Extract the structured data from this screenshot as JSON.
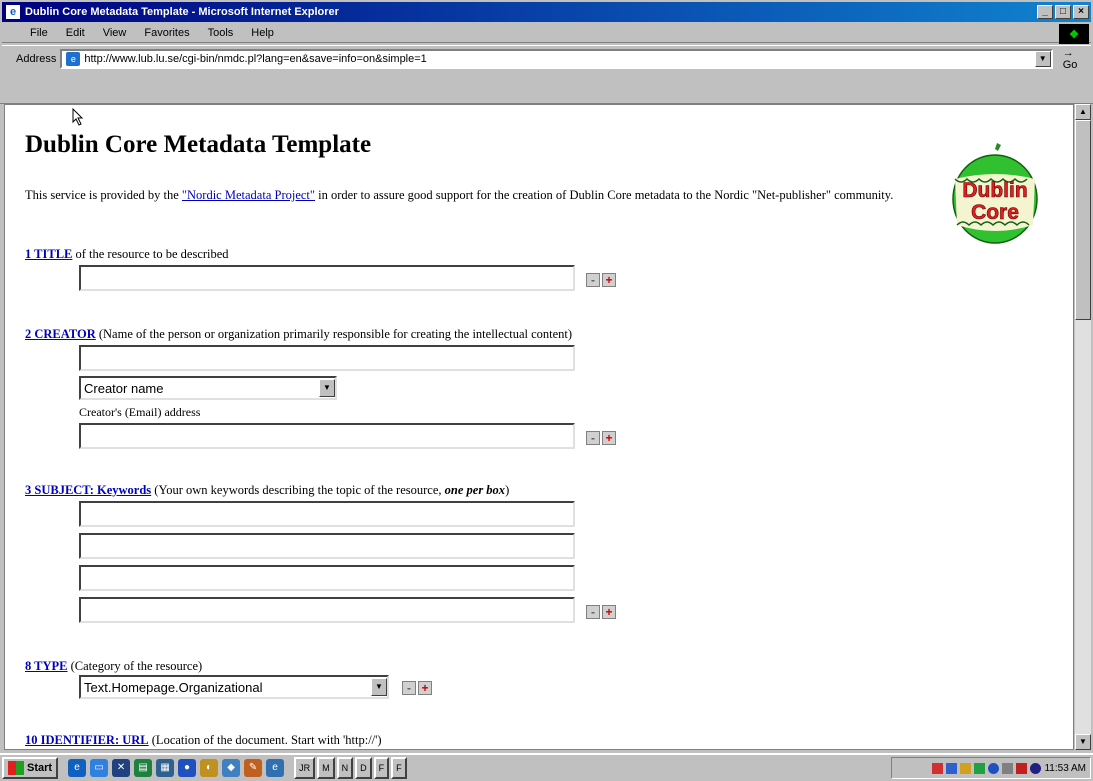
{
  "window": {
    "title": "Dublin Core Metadata Template - Microsoft Internet Explorer",
    "controls": [
      "_",
      "□",
      "×"
    ]
  },
  "menu": {
    "items": [
      "File",
      "Edit",
      "View",
      "Favorites",
      "Tools",
      "Help"
    ]
  },
  "address": {
    "label": "Address",
    "url": "http://www.lub.lu.se/cgi-bin/nmdc.pl?lang=en&save=info=on&simple=1",
    "go": "Go"
  },
  "page": {
    "title": "Dublin Core Metadata Template",
    "intro_before": "This service is provided by the ",
    "intro_link": "\"Nordic Metadata Project\"",
    "intro_after": " in order to assure good support for the creation of Dublin Core metadata to the Nordic \"Net-publisher\" community.",
    "logo_text_1": "Dublin",
    "logo_text_2": "Core"
  },
  "fields": {
    "title": {
      "link": "1 TITLE",
      "desc": " of the resource to be described"
    },
    "creator": {
      "link": "2 CREATOR",
      "desc": " (Name of the person or organization primarily responsible for creating the intellectual content)",
      "select_value": "Creator name",
      "email_label": "Creator's (Email) address"
    },
    "subject": {
      "link": "3 SUBJECT: Keywords",
      "desc_before": " (Your own keywords describing the topic of the resource, ",
      "desc_emph": "one per box",
      "desc_after": ")"
    },
    "type": {
      "link": "8 TYPE",
      "desc": " (Category of the resource)",
      "select_value": "Text.Homepage.Organizational"
    },
    "identifier": {
      "link": "10 IDENTIFIER: URL",
      "desc": " (Location of the document. Start with 'http://')"
    }
  },
  "buttons": {
    "minus": "-",
    "plus": "+"
  },
  "taskbar": {
    "start": "Start",
    "tasks": [
      "JR",
      "M",
      "N",
      "D",
      "F",
      "F"
    ],
    "clock": "11:53 AM"
  },
  "colors": {
    "title_bar": "#000080",
    "link": "#0000c0",
    "plus_button": "#d00000"
  }
}
